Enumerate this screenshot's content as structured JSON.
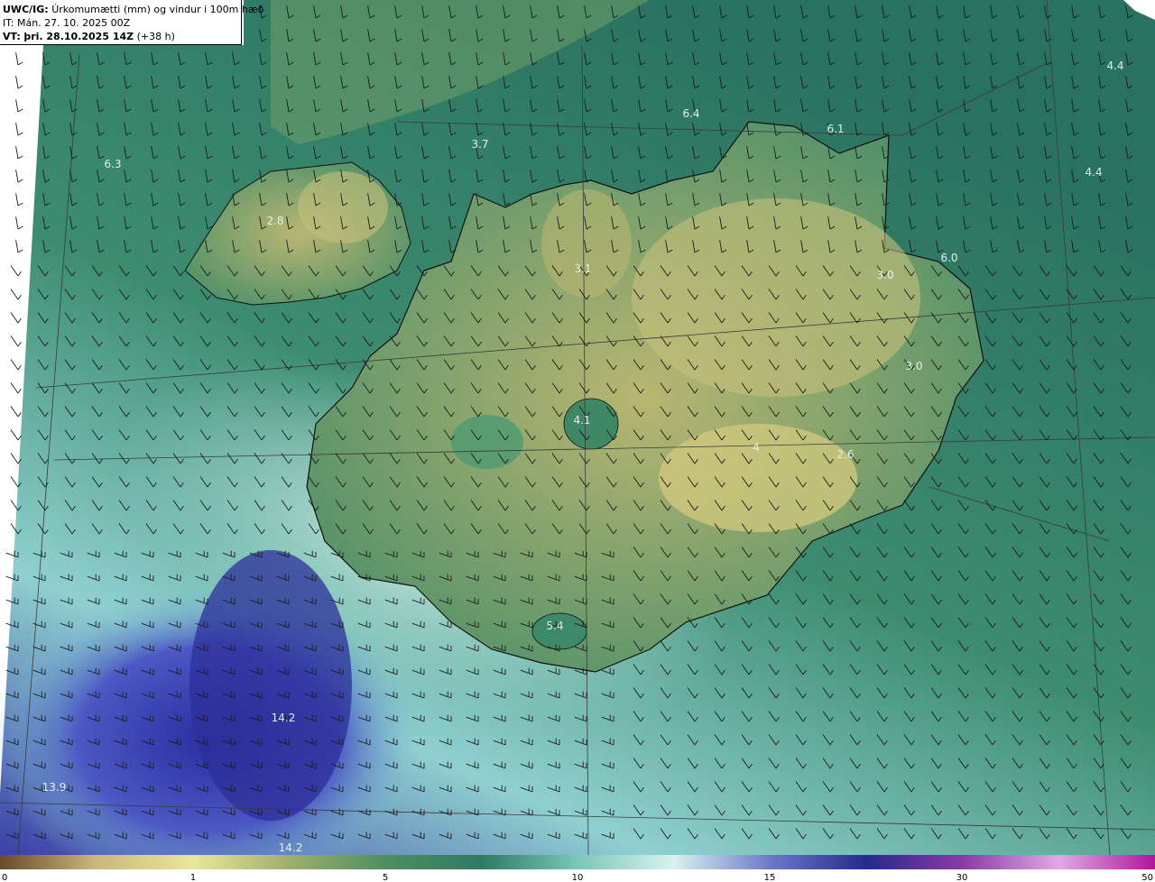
{
  "header": {
    "product": "UWC/IG:",
    "title": "Úrkomumætti (mm) og vindur i 100m hæð",
    "it_label": "IT:",
    "it_value": "Mán. 27. 10. 2025 00Z",
    "vt_label": "VT:",
    "vt_value": "þri. 28.10.2025 14Z",
    "vt_lead": "(+38 h)"
  },
  "map_labels": [
    {
      "text": "6.3"
    },
    {
      "text": "2.8"
    },
    {
      "text": "3.7"
    },
    {
      "text": "6.4"
    },
    {
      "text": "6.1"
    },
    {
      "text": "4.4"
    },
    {
      "text": "4.4"
    },
    {
      "text": "3.1"
    },
    {
      "text": "6.0"
    },
    {
      "text": "3.0"
    },
    {
      "text": "3.0"
    },
    {
      "text": "4.1"
    },
    {
      "text": "4"
    },
    {
      "text": "2.6"
    },
    {
      "text": "5.4"
    },
    {
      "text": "14.2"
    },
    {
      "text": "13.9"
    },
    {
      "text": "14.2"
    }
  ],
  "colorbar": {
    "ticks": [
      "0",
      "1",
      "5",
      "10",
      "15",
      "30",
      "50"
    ],
    "colors": [
      "#6b4a2a",
      "#c9b87a",
      "#e9e79a",
      "#9fb06a",
      "#4f8f62",
      "#2f7a63",
      "#79c7b9",
      "#d9f2ee",
      "#6c79c9",
      "#262a8c",
      "#8a3aa5",
      "#e0a9e2",
      "#b0159e"
    ]
  }
}
